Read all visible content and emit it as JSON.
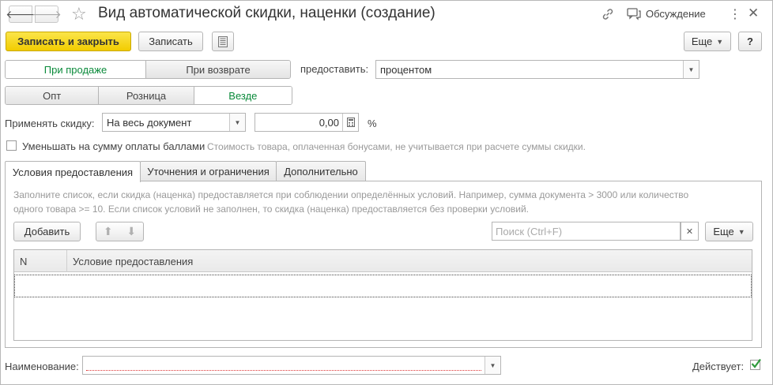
{
  "window": {
    "title": "Вид автоматической скидки, наценки (создание)",
    "discuss_label": "Обсуждение",
    "link_icon": "link-icon",
    "more_icon": "vertical-ellipsis-icon",
    "close_icon": "close-icon"
  },
  "toolbar": {
    "save_close_label": "Записать и закрыть",
    "save_label": "Записать",
    "more_label": "Еще",
    "help_label": "?"
  },
  "mode": {
    "items": [
      "При продаже",
      "При возврате"
    ],
    "active": "При продаже",
    "provide_label": "предоставить:",
    "provide_value": "процентом"
  },
  "scope": {
    "items": [
      "Опт",
      "Розница",
      "Везде"
    ],
    "active": "Везде"
  },
  "apply": {
    "label": "Применять скидку:",
    "value": "На весь документ",
    "amount": "0,00",
    "unit": "%"
  },
  "bonus": {
    "label": "Уменьшать на сумму оплаты баллами",
    "hint": "Стоимость товара, оплаченная бонусами, не учитывается при расчете суммы скидки.",
    "checked": false
  },
  "tabs": [
    "Условия предоставления",
    "Уточнения и ограничения",
    "Дополнительно"
  ],
  "conditions": {
    "info_line1": "Заполните список, если скидка (наценка) предоставляется при соблюдении определённых условий. Например, сумма документа > 3000 или количество",
    "info_line2": "одного товара >= 10. Если список условий не заполнен, то скидка (наценка) предоставляется без проверки условий.",
    "add_label": "Добавить",
    "search_placeholder": "Поиск (Ctrl+F)",
    "more_label": "Еще",
    "columns": [
      "N",
      "Условие предоставления"
    ]
  },
  "footer": {
    "name_label": "Наименование:",
    "active_label": "Действует:",
    "active_checked": true
  },
  "colors": {
    "primary_button": "#f2cc00",
    "active_segment_text": "#0a8a3a",
    "checkmark": "#2e9a3c"
  }
}
